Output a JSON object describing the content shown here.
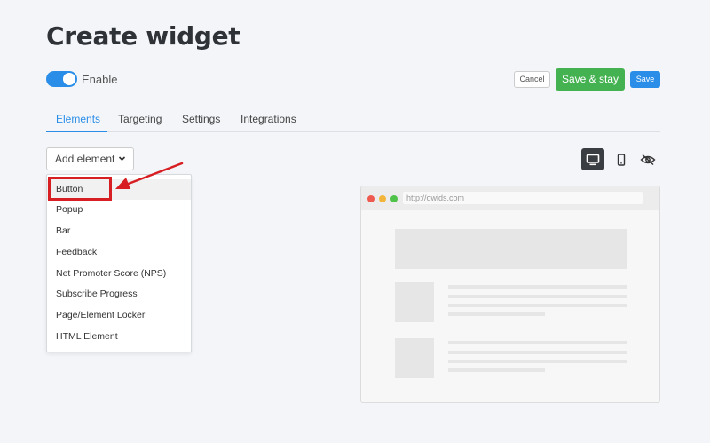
{
  "page": {
    "title": "Create widget"
  },
  "enable": {
    "label": "Enable",
    "on": true
  },
  "actions": {
    "cancel": "Cancel",
    "save_stay": "Save & stay",
    "save": "Save"
  },
  "tabs": [
    {
      "label": "Elements",
      "active": true
    },
    {
      "label": "Targeting",
      "active": false
    },
    {
      "label": "Settings",
      "active": false
    },
    {
      "label": "Integrations",
      "active": false
    }
  ],
  "add_element": {
    "label": "Add element",
    "icon": "chevron-down-icon"
  },
  "dropdown": {
    "items": [
      "Button",
      "Popup",
      "Bar",
      "Feedback",
      "Net Promoter Score (NPS)",
      "Subscribe Progress",
      "Page/Element Locker",
      "HTML Element"
    ],
    "highlighted_index": 0
  },
  "view_modes": {
    "items": [
      "desktop-icon",
      "mobile-icon",
      "hide-icon"
    ],
    "active": "desktop-icon"
  },
  "preview": {
    "url": "http://owids.com"
  },
  "colors": {
    "accent": "#2a8ee8",
    "save_stay": "#45b252",
    "annotation": "#d71e22"
  }
}
